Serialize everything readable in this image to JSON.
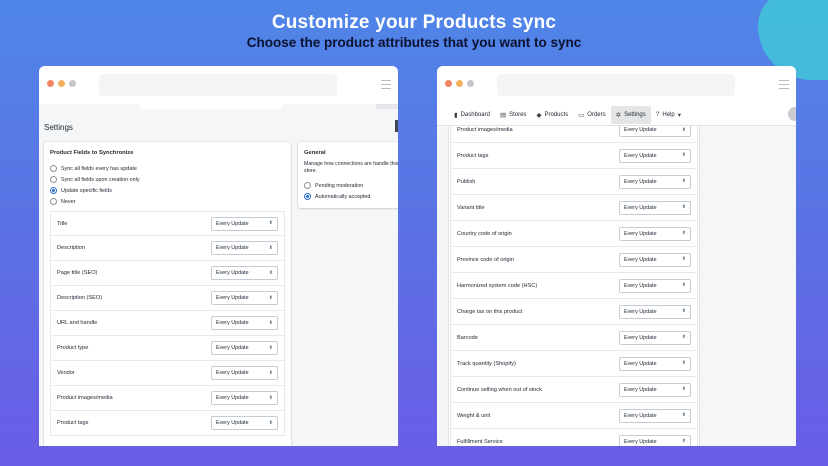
{
  "header": {
    "title": "Customize your Products sync",
    "subtitle": "Choose the product attributes that you want to sync"
  },
  "colors": {
    "dot_red": "#f0855f",
    "dot_yellow": "#f3b162",
    "dot_gray": "#c3c6cb",
    "accent": "#2c6ecb"
  },
  "left": {
    "page_title": "Settings",
    "fields_card": {
      "title": "Product Fields to Synchronize",
      "options": [
        {
          "label": "Sync all fields every has update",
          "selected": false
        },
        {
          "label": "Sync all fields upon creation only",
          "selected": false
        },
        {
          "label": "Update specific fields",
          "selected": true
        },
        {
          "label": "Never",
          "selected": false
        }
      ],
      "rows": [
        {
          "label": "Title",
          "value": "Every Update"
        },
        {
          "label": "Description",
          "value": "Every Update"
        },
        {
          "label": "Page title (SEO)",
          "value": "Every Update"
        },
        {
          "label": "Description (SEO)",
          "value": "Every Update"
        },
        {
          "label": "URL and handle",
          "value": "Every Update"
        },
        {
          "label": "Product type",
          "value": "Every Update"
        },
        {
          "label": "Vendor",
          "value": "Every Update"
        },
        {
          "label": "Product images/media",
          "value": "Every Update"
        },
        {
          "label": "Product tags",
          "value": "Every Update"
        }
      ]
    },
    "general_card": {
      "title": "General",
      "text": "Manage how connections are handle this store.",
      "options": [
        {
          "label": "Pending moderation",
          "selected": false
        },
        {
          "label": "Automatically accepted",
          "selected": true
        }
      ]
    }
  },
  "right": {
    "nav": [
      {
        "label": "Dashboard",
        "icon": "bar-chart-icon",
        "glyph": "▮"
      },
      {
        "label": "Stores",
        "icon": "store-icon",
        "glyph": "▤"
      },
      {
        "label": "Products",
        "icon": "tag-icon",
        "glyph": "◆"
      },
      {
        "label": "Orders",
        "icon": "orders-icon",
        "glyph": "▭"
      },
      {
        "label": "Settings",
        "icon": "gear-icon",
        "glyph": "✲",
        "active": true
      },
      {
        "label": "Help",
        "icon": "help-icon",
        "glyph": "?",
        "dropdown": "▾"
      }
    ],
    "rows": [
      {
        "label": "Product images/media",
        "value": "Every Update"
      },
      {
        "label": "Product tags",
        "value": "Every Update"
      },
      {
        "label": "Publish",
        "value": "Every Update"
      },
      {
        "label": "Variant title",
        "value": "Every Update"
      },
      {
        "label": "Country code of origin",
        "value": "Every Update"
      },
      {
        "label": "Province code of origin",
        "value": "Every Update"
      },
      {
        "label": "Harmonized system code (HSC)",
        "value": "Every Update"
      },
      {
        "label": "Charge tax on this product",
        "value": "Every Update"
      },
      {
        "label": "Barcode",
        "value": "Every Update"
      },
      {
        "label": "Track quantity (Shopify)",
        "value": "Every Update"
      },
      {
        "label": "Continue selling when out of stock",
        "value": "Every Update"
      },
      {
        "label": "Weight & unit",
        "value": "Every Update"
      },
      {
        "label": "Fulfillment Service",
        "value": "Every Update"
      }
    ]
  }
}
